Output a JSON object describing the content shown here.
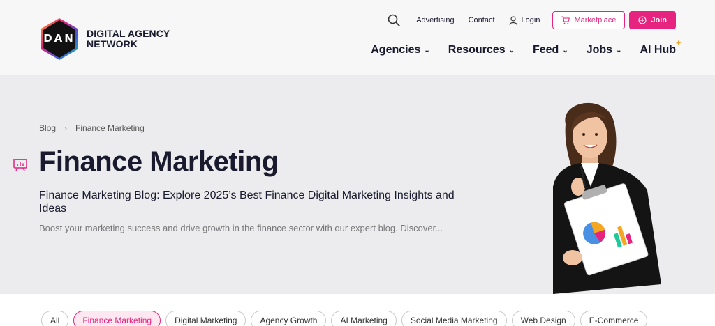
{
  "brand": {
    "logo_mark": "DAN",
    "line1": "DIGITAL AGENCY",
    "line2": "NETWORK"
  },
  "topbar": {
    "search_icon": "search-icon",
    "advertising": "Advertising",
    "contact": "Contact",
    "login": "Login",
    "marketplace": "Marketplace",
    "join": "Join"
  },
  "nav": {
    "agencies": "Agencies",
    "resources": "Resources",
    "feed": "Feed",
    "jobs": "Jobs",
    "ai_hub": "AI Hub"
  },
  "hero": {
    "breadcrumb": {
      "home": "Blog",
      "sep": "›",
      "current": "Finance Marketing"
    },
    "title": "Finance Marketing",
    "subtitle": "Finance Marketing Blog: Explore 2025’s Best Finance Digital Marketing Insights and Ideas",
    "description": "Boost your marketing success and drive growth in the finance sector with our expert blog. Discover..."
  },
  "filters": [
    {
      "label": "All"
    },
    {
      "label": "Finance Marketing",
      "active": true
    },
    {
      "label": "Digital Marketing"
    },
    {
      "label": "Agency Growth"
    },
    {
      "label": "AI Marketing"
    },
    {
      "label": "Social Media Marketing"
    },
    {
      "label": "Web Design"
    },
    {
      "label": "E-Commerce"
    }
  ],
  "colors": {
    "accent": "#e6237e",
    "text": "#1a1a2e",
    "hero_bg": "#ececee"
  }
}
